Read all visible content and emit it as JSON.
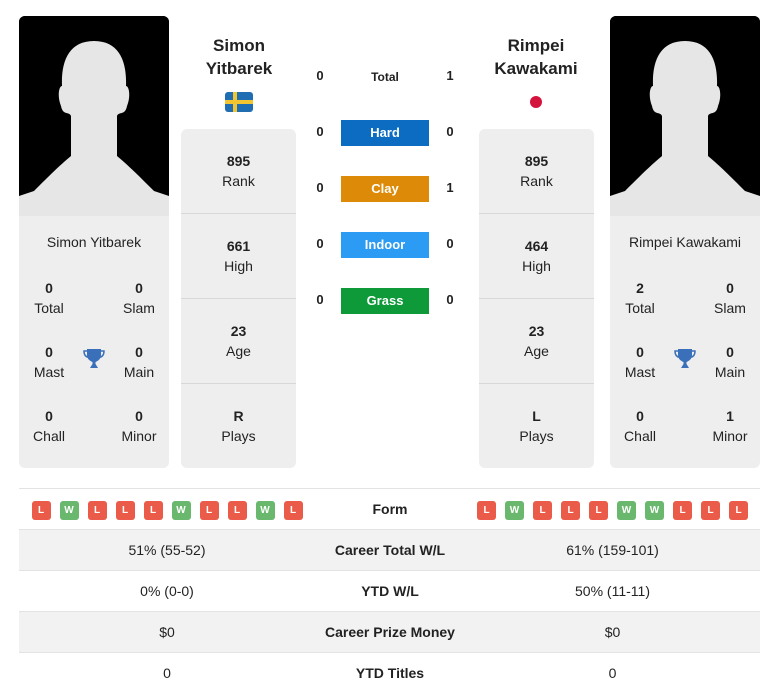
{
  "colors": {
    "hard": "#0b6cc2",
    "clay": "#dc8a07",
    "indoor": "#2b9bf3",
    "grass": "#0f9a3a",
    "loss_badge": "#ea5c49",
    "win_badge": "#6ab86e",
    "trophy": "#3a6fba"
  },
  "player1": {
    "name_line1": "Simon",
    "name_line2": "Yitbarek",
    "full_name": "Simon Yitbarek",
    "flag": "sweden-flag",
    "rank": "895",
    "rank_label": "Rank",
    "high": "661",
    "high_label": "High",
    "age": "23",
    "age_label": "Age",
    "plays": "R",
    "plays_label": "Plays",
    "titles": {
      "total": "0",
      "total_label": "Total",
      "slam": "0",
      "slam_label": "Slam",
      "mast": "0",
      "mast_label": "Mast",
      "main": "0",
      "main_label": "Main",
      "chall": "0",
      "chall_label": "Chall",
      "minor": "0",
      "minor_label": "Minor"
    },
    "form": [
      "L",
      "W",
      "L",
      "L",
      "L",
      "W",
      "L",
      "L",
      "W",
      "L"
    ]
  },
  "player2": {
    "name_line1": "Rimpei",
    "name_line2": "Kawakami",
    "full_name": "Rimpei Kawakami",
    "flag": "japan-flag",
    "rank": "895",
    "rank_label": "Rank",
    "high": "464",
    "high_label": "High",
    "age": "23",
    "age_label": "Age",
    "plays": "L",
    "plays_label": "Plays",
    "titles": {
      "total": "2",
      "total_label": "Total",
      "slam": "0",
      "slam_label": "Slam",
      "mast": "0",
      "mast_label": "Mast",
      "main": "0",
      "main_label": "Main",
      "chall": "0",
      "chall_label": "Chall",
      "minor": "1",
      "minor_label": "Minor"
    },
    "form": [
      "L",
      "W",
      "L",
      "L",
      "L",
      "W",
      "W",
      "L",
      "L",
      "L"
    ]
  },
  "h2h": {
    "total": {
      "label": "Total",
      "p1": "0",
      "p2": "1"
    },
    "hard": {
      "label": "Hard",
      "p1": "0",
      "p2": "0"
    },
    "clay": {
      "label": "Clay",
      "p1": "0",
      "p2": "1"
    },
    "indoor": {
      "label": "Indoor",
      "p1": "0",
      "p2": "0"
    },
    "grass": {
      "label": "Grass",
      "p1": "0",
      "p2": "0"
    }
  },
  "comparison": {
    "form_label": "Form",
    "rows": [
      {
        "label": "Career Total W/L",
        "p1": "51% (55-52)",
        "p2": "61% (159-101)"
      },
      {
        "label": "YTD W/L",
        "p1": "0% (0-0)",
        "p2": "50% (11-11)"
      },
      {
        "label": "Career Prize Money",
        "p1": "$0",
        "p2": "$0"
      },
      {
        "label": "YTD Titles",
        "p1": "0",
        "p2": "0"
      }
    ]
  }
}
